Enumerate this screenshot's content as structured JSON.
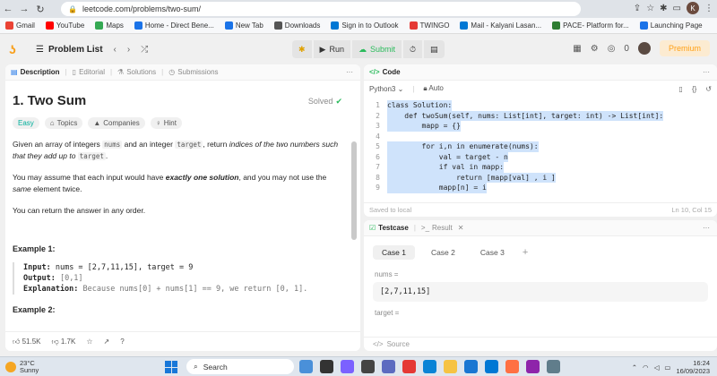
{
  "browser": {
    "url": "leetcode.com/problems/two-sum/",
    "profile_initial": "K",
    "bookmarks": [
      "Gmail",
      "YouTube",
      "Maps",
      "Home - Direct Bene...",
      "New Tab",
      "Downloads",
      "Sign in to Outlook",
      "TWINGO",
      "Mail - Kalyani Lasan...",
      "PACE- Platform for...",
      "Launching Page"
    ],
    "bookmark_colors": [
      "#ea4335",
      "#ff0000",
      "#34a853",
      "#1a73e8",
      "#1a73e8",
      "#555555",
      "#0078d4",
      "#e53935",
      "#0078d4",
      "#2e7d32",
      "#1a73e8"
    ]
  },
  "header": {
    "problem_list": "Problem List",
    "run": "Run",
    "submit": "Submit",
    "coins": "0",
    "premium": "Premium"
  },
  "left_tabs": {
    "description": "Description",
    "editorial": "Editorial",
    "solutions": "Solutions",
    "submissions": "Submissions"
  },
  "problem": {
    "title": "1. Two Sum",
    "solved": "Solved",
    "tags": [
      "Easy",
      "Topics",
      "Companies",
      "Hint"
    ],
    "p1_a": "Given an array of integers ",
    "p1_code1": "nums",
    "p1_b": " and an integer ",
    "p1_code2": "target",
    "p1_c": ", return ",
    "p1_em": "indices of the two numbers such that they add up to",
    "p1_code3": "target",
    "p1_d": ".",
    "p2_a": "You may assume that each input would have ",
    "p2_strong": "exactly one solution",
    "p2_b": ", and you may not use the ",
    "p2_em": "same",
    "p2_c": " element twice.",
    "p3": "You can return the answer in any order.",
    "example1_title": "Example 1:",
    "input_label": "Input:",
    "input_value": "nums = [2,7,11,15], target = 9",
    "output_label": "Output:",
    "output_value": "[0,1]",
    "explanation_label": "Explanation:",
    "explanation_value": "Because nums[0] + nums[1] == 9, we return [0, 1].",
    "example2_title": "Example 2:",
    "likes": "51.5K",
    "dislikes": "1.7K"
  },
  "code_panel": {
    "tab": "Code",
    "language": "Python3",
    "auto": "Auto",
    "lines": [
      {
        "n": "1",
        "text": "class Solution:"
      },
      {
        "n": "2",
        "text": "    def twoSum(self, nums: List[int], target: int) -> List[int]:"
      },
      {
        "n": "3",
        "text": "        mapp = {}"
      },
      {
        "n": "4",
        "text": ""
      },
      {
        "n": "5",
        "text": "        for i,n in enumerate(nums):"
      },
      {
        "n": "6",
        "text": "            val = target - n"
      },
      {
        "n": "7",
        "text": "            if val in mapp:"
      },
      {
        "n": "8",
        "text": "                return [mapp[val] , i ]"
      },
      {
        "n": "9",
        "text": "            mapp[n] = i"
      }
    ],
    "saved": "Saved to local",
    "cursor": "Ln 10, Col 15"
  },
  "test_panel": {
    "testcase_tab": "Testcase",
    "result_tab": "Result",
    "cases": [
      "Case 1",
      "Case 2",
      "Case 3"
    ],
    "nums_label": "nums =",
    "nums_value": "[2,7,11,15]",
    "target_label": "target =",
    "source": "Source"
  },
  "taskbar": {
    "temp": "23°C",
    "weather": "Sunny",
    "search": "Search",
    "time": "16:24",
    "date": "16/09/2023"
  }
}
